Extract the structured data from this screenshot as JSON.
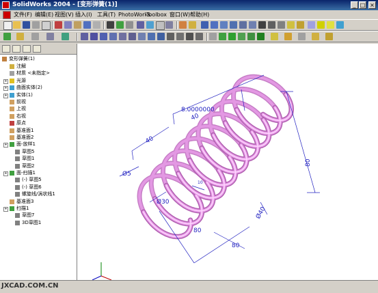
{
  "window": {
    "title": "SolidWorks 2004 - [变形弹簧(1)]",
    "minimize": "_",
    "maximize": "□",
    "close": "×"
  },
  "menu": [
    "文件(F)",
    "编辑(E)",
    "视图(V)",
    "插入(I)",
    "工具(T)",
    "PhotoWorks",
    "Toolbox",
    "窗口(W)",
    "帮助(H)"
  ],
  "tree": {
    "root": "变形弹簧(1)",
    "items": [
      {
        "label": "注解",
        "level": 1
      },
      {
        "label": "材质 <未指定>",
        "level": 1
      },
      {
        "label": "光源",
        "level": 1
      },
      {
        "label": "曲面实体(2)",
        "level": 1
      },
      {
        "label": "实体(1)",
        "level": 1
      },
      {
        "label": "前视",
        "level": 1
      },
      {
        "label": "上视",
        "level": 1
      },
      {
        "label": "右视",
        "level": 1
      },
      {
        "label": "原点",
        "level": 1
      },
      {
        "label": "基准面1",
        "level": 1
      },
      {
        "label": "基准面2",
        "level": 1
      },
      {
        "label": "面-放样1",
        "level": 1
      },
      {
        "label": "草图5",
        "level": 2
      },
      {
        "label": "草图1",
        "level": 2
      },
      {
        "label": "草图2",
        "level": 2
      },
      {
        "label": "面-扫描1",
        "level": 1
      },
      {
        "label": "(-) 草图5",
        "level": 2
      },
      {
        "label": "(-) 草图6",
        "level": 2
      },
      {
        "label": "螺旋线/涡状线1",
        "level": 2
      },
      {
        "label": "基准面3",
        "level": 1
      },
      {
        "label": "扫描1",
        "level": 1
      },
      {
        "label": "草图7",
        "level": 2
      },
      {
        "label": "3D草图1",
        "level": 2
      }
    ]
  },
  "dimensions": {
    "d1": "8.0000000",
    "d2": "40",
    "d3": "40",
    "d4": "Ø5",
    "d5": "Ø30",
    "d6": "Ø40",
    "d7": "80",
    "d8": "80",
    "d9": "80",
    "d10": "10"
  },
  "watermark": "JXCAD.COM.CN",
  "colors": {
    "spring": "#e69be6",
    "dimension": "#2020c0",
    "title_bar": "#0a246a"
  }
}
